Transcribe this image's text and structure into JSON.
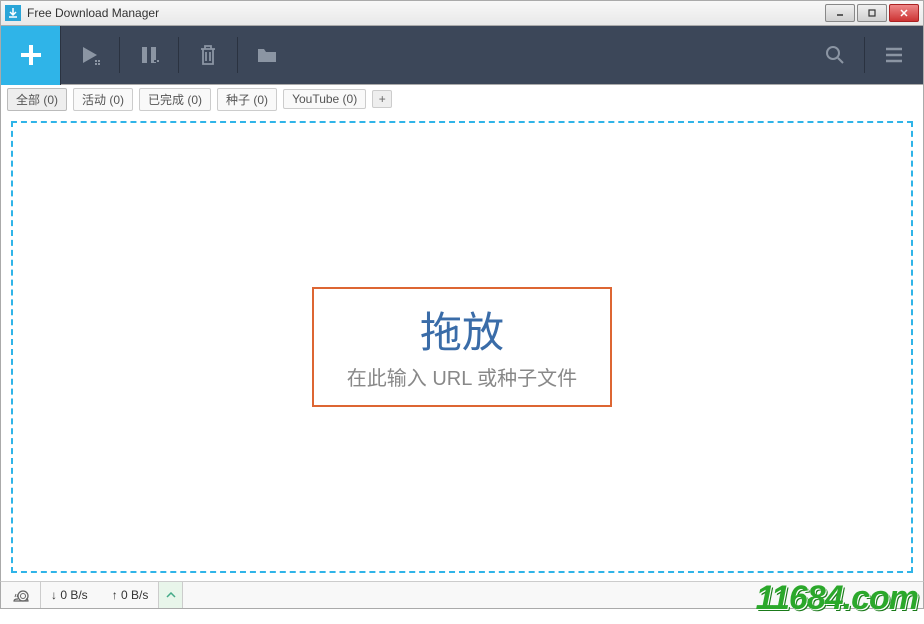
{
  "window": {
    "title": "Free Download Manager"
  },
  "tabs": [
    {
      "label": "全部 (0)",
      "active": true
    },
    {
      "label": "活动 (0)",
      "active": false
    },
    {
      "label": "已完成 (0)",
      "active": false
    },
    {
      "label": "种子 (0)",
      "active": false
    },
    {
      "label": "YouTube (0)",
      "active": false
    }
  ],
  "dropzone": {
    "title": "拖放",
    "subtitle": "在此输入 URL 或种子文件"
  },
  "status": {
    "download_speed": "↓ 0 B/s",
    "upload_speed": "↑ 0 B/s"
  },
  "watermark": "11684.com"
}
